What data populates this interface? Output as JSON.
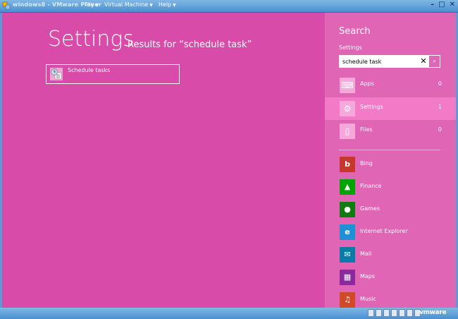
{
  "window": {
    "title": "windows8 - VMware Player",
    "menu": [
      "File",
      "Virtual Machine",
      "Help"
    ],
    "controls": {
      "minimize": "–",
      "maximize": "□",
      "close": "✕"
    }
  },
  "colors": {
    "left_bg": "#d94ba9",
    "right_bg": "#e065b5",
    "selected_bg": "#f37ac6",
    "bing": "#c8372d",
    "finance": "#00a300",
    "games": "#107c10",
    "ie": "#1e90d6",
    "mail": "#0a7aa8",
    "maps": "#8a2a9e",
    "music": "#d04a2a"
  },
  "main": {
    "title": "Settings",
    "results_for": "Results for “schedule task”",
    "results": [
      {
        "label": "Schedule tasks",
        "icon": "task-scheduler-icon"
      }
    ]
  },
  "search": {
    "title": "Search",
    "scope": "Settings",
    "query": "schedule task",
    "clear_label": "✕",
    "search_icon": "⌕",
    "categories": [
      {
        "label": "Apps",
        "count": "0",
        "icon": "keyboard-icon",
        "glyph": "⌨"
      },
      {
        "label": "Settings",
        "count": "1",
        "icon": "gear-icon",
        "glyph": "⚙"
      },
      {
        "label": "Files",
        "count": "0",
        "icon": "file-icon",
        "glyph": "▯"
      }
    ],
    "apps": [
      {
        "label": "Bing",
        "icon": "bing-icon",
        "glyph": "b"
      },
      {
        "label": "Finance",
        "icon": "finance-icon",
        "glyph": "▲"
      },
      {
        "label": "Games",
        "icon": "games-icon",
        "glyph": "●"
      },
      {
        "label": "Internet Explorer",
        "icon": "internet-explorer-icon",
        "glyph": "e"
      },
      {
        "label": "Mail",
        "icon": "mail-icon",
        "glyph": "✉"
      },
      {
        "label": "Maps",
        "icon": "maps-icon",
        "glyph": "▦"
      },
      {
        "label": "Music",
        "icon": "music-icon",
        "glyph": "♫"
      }
    ]
  },
  "statusbar": {
    "brand": "vmware"
  }
}
